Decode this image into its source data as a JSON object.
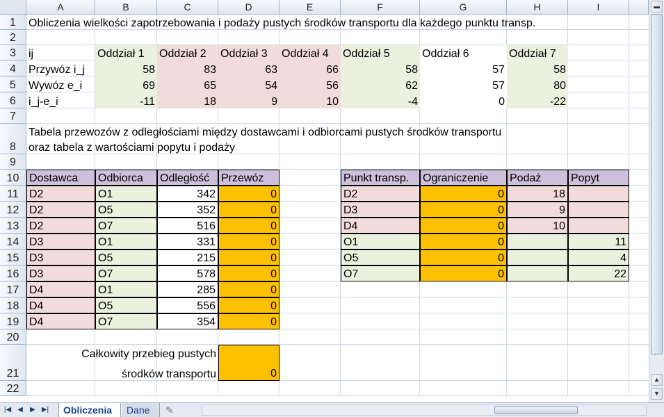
{
  "columns": [
    "A",
    "B",
    "C",
    "D",
    "E",
    "F",
    "G",
    "H",
    "I"
  ],
  "rows": [
    "1",
    "2",
    "3",
    "4",
    "5",
    "6",
    "7",
    "8",
    "9",
    "10",
    "11",
    "12",
    "13",
    "14",
    "15",
    "16",
    "17",
    "18",
    "19",
    "20",
    "21",
    "22"
  ],
  "title": "Obliczenia wielkości zapotrzebowania i podaży pustych środków transportu dla każdego punktu transp.",
  "summary_table": {
    "row_labels": [
      "ij",
      "Przywóz i_j",
      "Wywóz e_i",
      "i_j-e_i"
    ],
    "headers": [
      "Oddział 1",
      "Oddział 2",
      "Oddział 3",
      "Oddział 4",
      "Oddział 5",
      "Oddział 6",
      "Oddział 7"
    ],
    "przywoz": [
      "58",
      "83",
      "63",
      "66",
      "58",
      "57",
      "58"
    ],
    "wywoz": [
      "69",
      "65",
      "54",
      "56",
      "62",
      "57",
      "80"
    ],
    "diff": [
      "-11",
      "18",
      "9",
      "10",
      "-4",
      "0",
      "-22"
    ]
  },
  "section_title_1": "Tabela przewozów z odległościami między dostawcami i odbiorcami pustych środków transportu",
  "section_title_2": "oraz tabela z wartościami popytu i podaży",
  "transport_table": {
    "headers": [
      "Dostawca",
      "Odbiorca",
      "Odległość",
      "Przewóz"
    ],
    "rows": [
      [
        "D2",
        "O1",
        "342",
        "0"
      ],
      [
        "D2",
        "O5",
        "352",
        "0"
      ],
      [
        "D2",
        "O7",
        "516",
        "0"
      ],
      [
        "D3",
        "O1",
        "331",
        "0"
      ],
      [
        "D3",
        "O5",
        "215",
        "0"
      ],
      [
        "D3",
        "O7",
        "578",
        "0"
      ],
      [
        "D4",
        "O1",
        "285",
        "0"
      ],
      [
        "D4",
        "O5",
        "556",
        "0"
      ],
      [
        "D4",
        "O7",
        "354",
        "0"
      ]
    ]
  },
  "constraints_table": {
    "headers": [
      "Punkt transp.",
      "Ograniczenie",
      "Podaż",
      "Popyt"
    ],
    "rows": [
      [
        "D2",
        "0",
        "18",
        ""
      ],
      [
        "D3",
        "0",
        "9",
        ""
      ],
      [
        "D4",
        "0",
        "10",
        ""
      ],
      [
        "O1",
        "0",
        "",
        "11"
      ],
      [
        "O5",
        "0",
        "",
        "4"
      ],
      [
        "O7",
        "0",
        "",
        "22"
      ]
    ]
  },
  "total_label_1": "Całkowity przebieg pustych",
  "total_label_2": "środków transportu",
  "total_value": "0",
  "sheet_tabs": [
    "Obliczenia",
    "Dane"
  ],
  "colors": {
    "green": "#ebf1de",
    "pink": "#f2dcdb",
    "purple": "#ccc0da",
    "orange": "#ffc000"
  },
  "icons": [
    "first-sheet-icon",
    "prev-sheet-icon",
    "next-sheet-icon",
    "last-sheet-icon",
    "insert-sheet-icon"
  ]
}
